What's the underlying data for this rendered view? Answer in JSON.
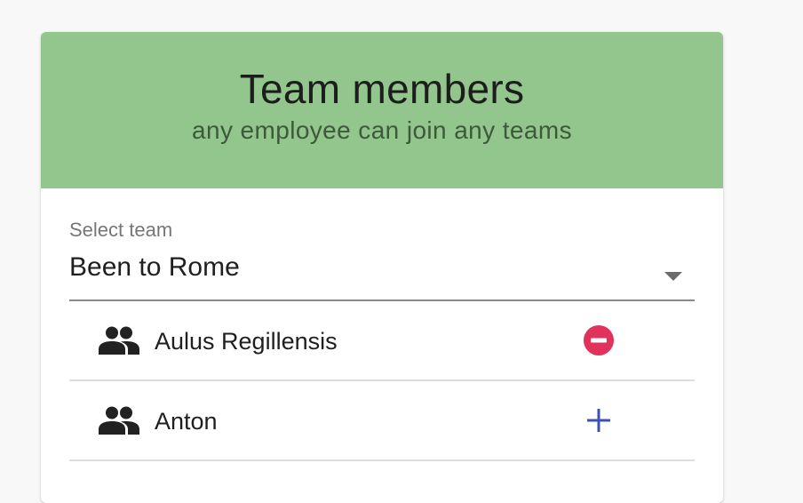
{
  "card": {
    "title": "Team members",
    "subtitle": "any employee can join any teams",
    "header_color": "#93c68c"
  },
  "team_select": {
    "label": "Select team",
    "value": "Been to Rome"
  },
  "members": [
    {
      "name": "Aulus Regillensis",
      "icon": "group-icon",
      "action": "remove",
      "action_icon": "remove-circle-icon",
      "action_color": "#e0325a"
    },
    {
      "name": "Anton",
      "icon": "group-icon",
      "action": "add",
      "action_icon": "add-icon",
      "action_color": "#3f51b5"
    }
  ]
}
